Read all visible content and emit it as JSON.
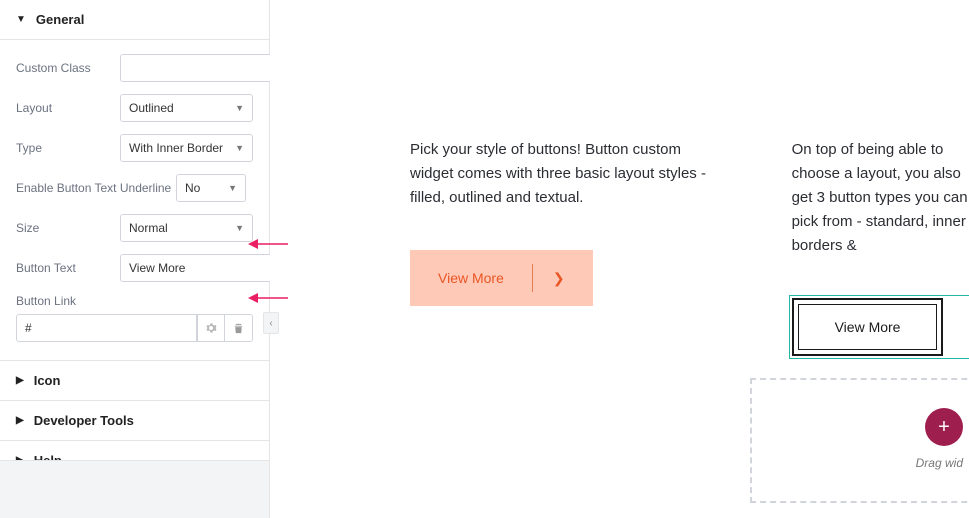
{
  "accordion": {
    "general": "General",
    "icon": "Icon",
    "developerTools": "Developer Tools",
    "help": "Help"
  },
  "fields": {
    "customClass": {
      "label": "Custom Class",
      "value": ""
    },
    "layout": {
      "label": "Layout",
      "value": "Outlined"
    },
    "type": {
      "label": "Type",
      "value": "With Inner Border"
    },
    "enableUnderline": {
      "label": "Enable Button Text Underline",
      "value": "No"
    },
    "size": {
      "label": "Size",
      "value": "Normal"
    },
    "buttonText": {
      "label": "Button Text",
      "value": "View More"
    },
    "buttonLink": {
      "label": "Button Link",
      "value": "#"
    }
  },
  "preview": {
    "desc1": "Pick your style of buttons! Button custom widget comes with three basic layout styles - filled, outlined and textual.",
    "desc2": "On top of being able to choose a layout, you also get 3 button types you can pick from - standard, inner borders & ",
    "btn1": "View More",
    "btn2": "View More"
  },
  "dropzone": {
    "hint": "Drag wid",
    "fab": "+"
  }
}
